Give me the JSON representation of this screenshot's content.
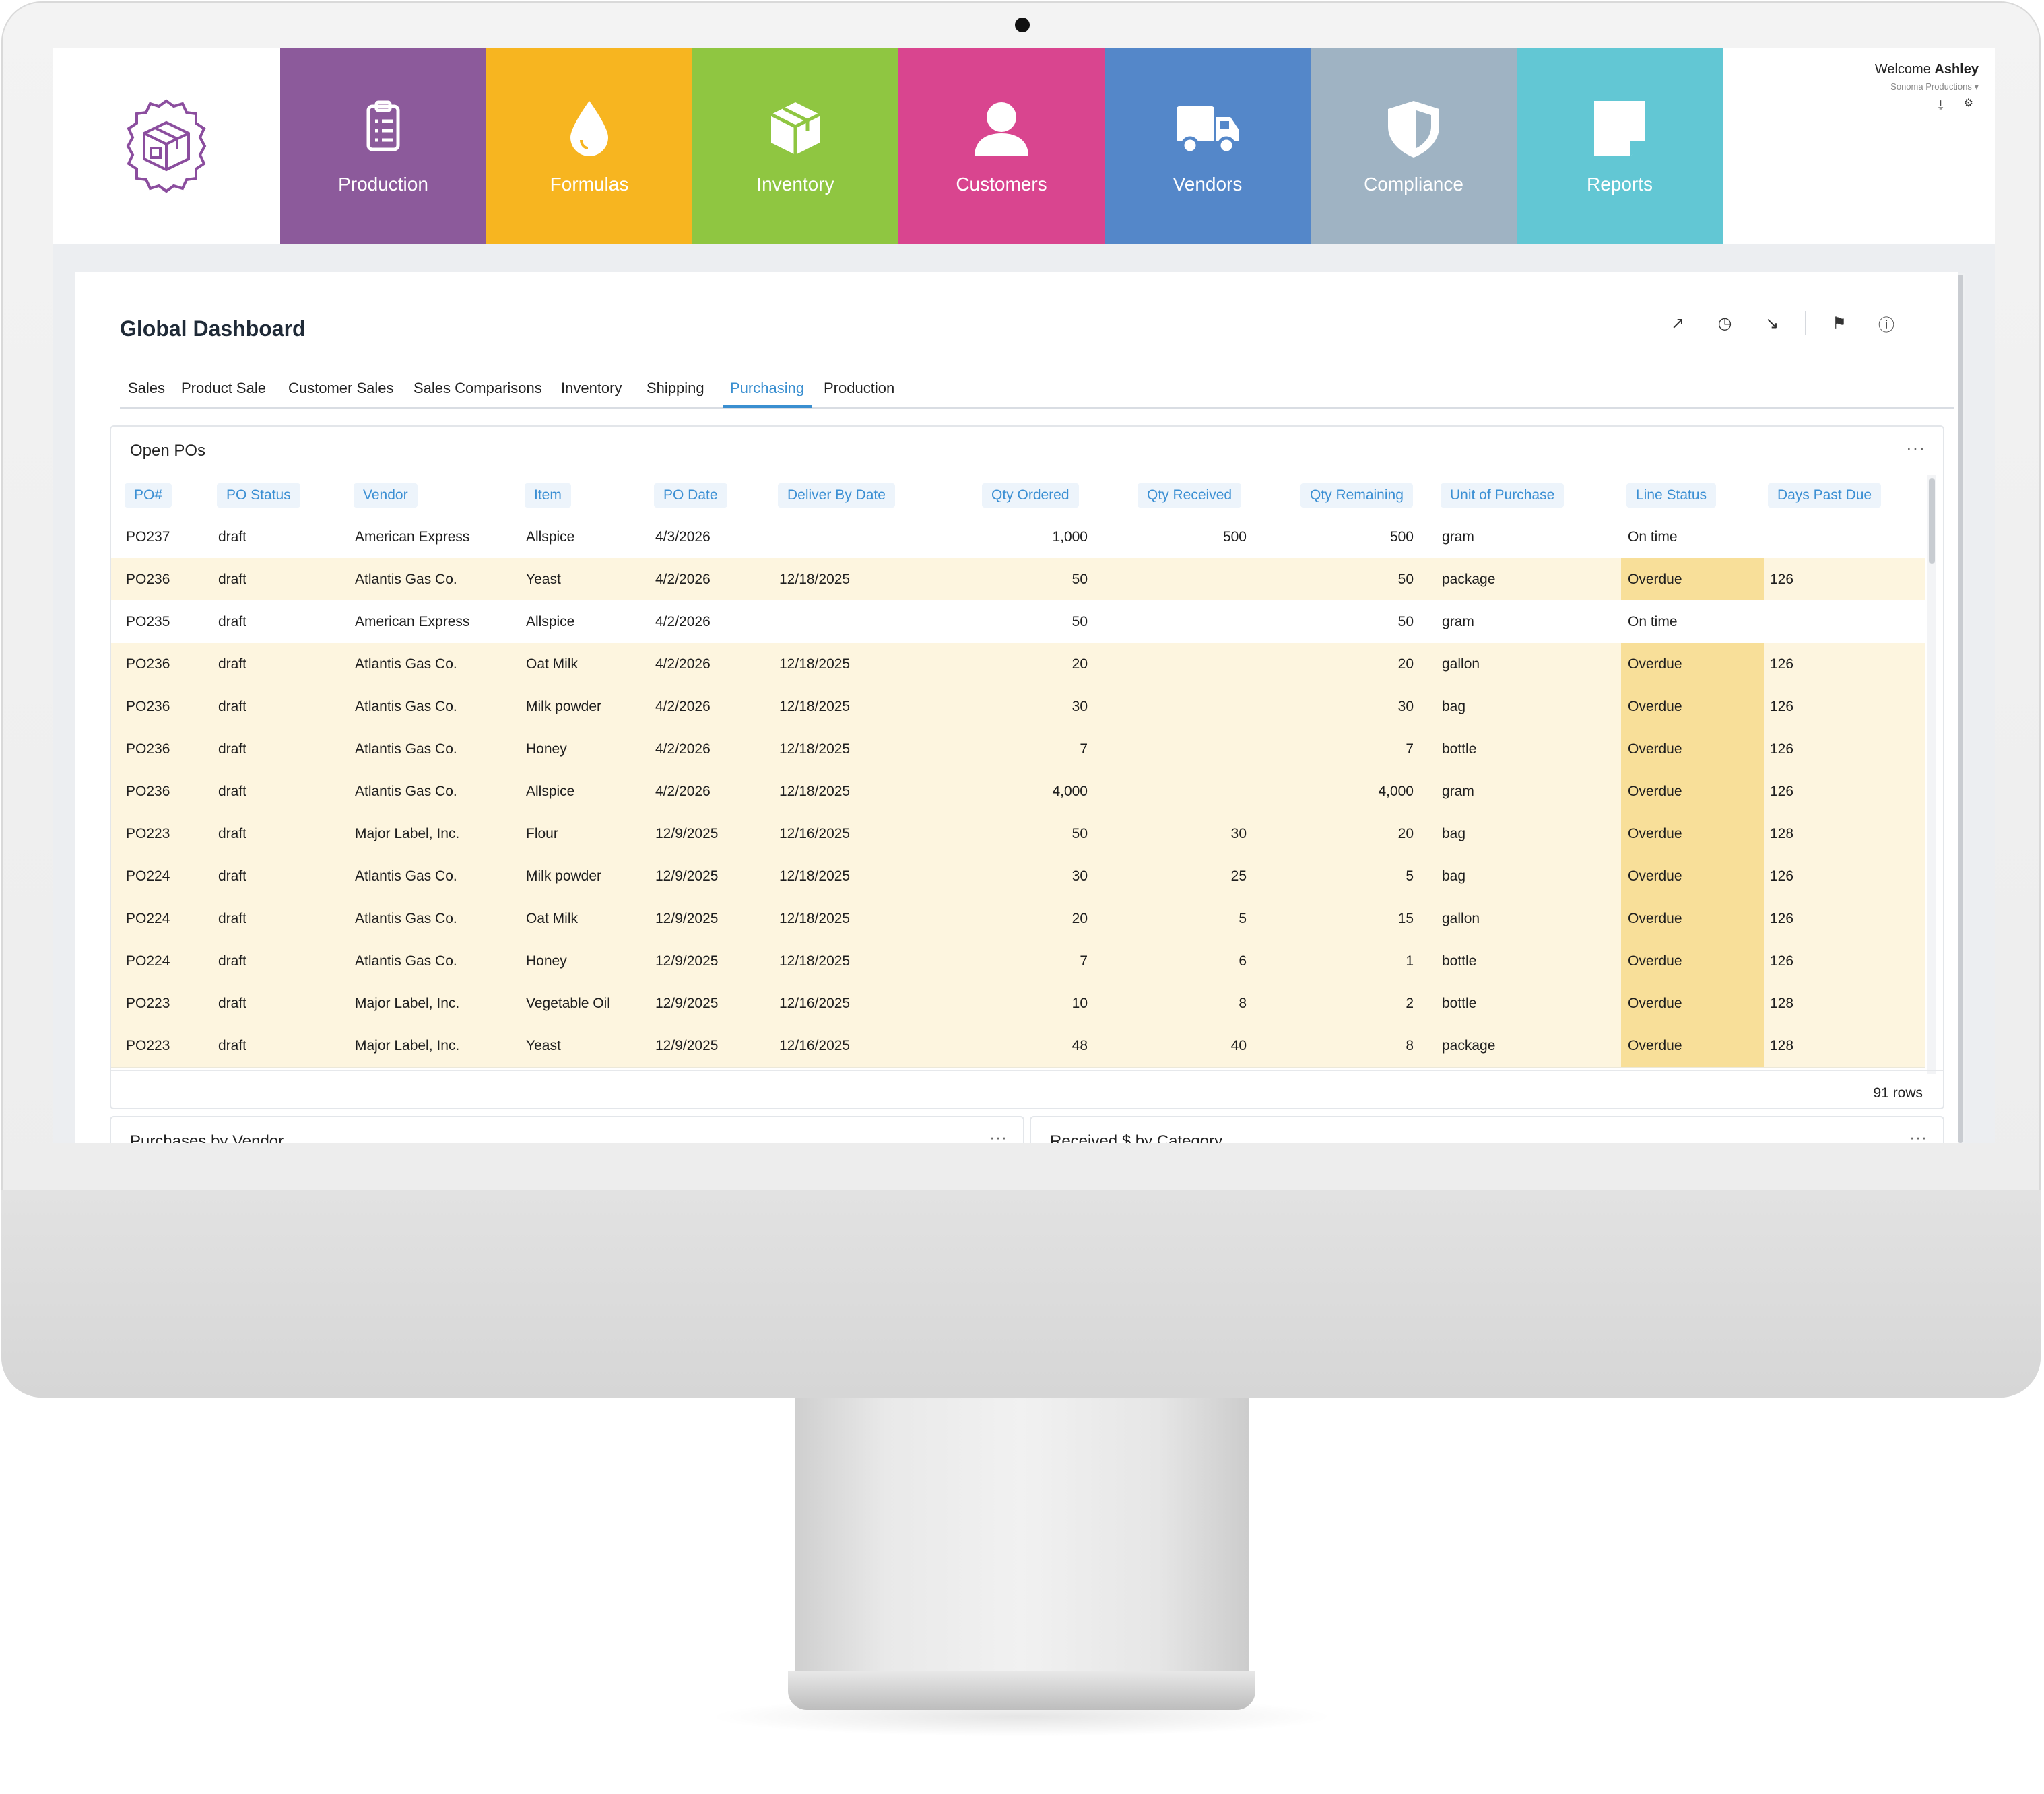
{
  "brand": {
    "logo_icon": "box-badge-icon",
    "logo_color": "#8b4d9e"
  },
  "modules": [
    {
      "label": "Production",
      "icon": "clipboard-icon",
      "color": "#8c5a9b"
    },
    {
      "label": "Formulas",
      "icon": "drop-icon",
      "color": "#f7b520"
    },
    {
      "label": "Inventory",
      "icon": "cube-icon",
      "color": "#8fc641"
    },
    {
      "label": "Customers",
      "icon": "person-icon",
      "color": "#d9458f"
    },
    {
      "label": "Vendors",
      "icon": "truck-icon",
      "color": "#5487c9"
    },
    {
      "label": "Compliance",
      "icon": "shield-icon",
      "color": "#9fb3c3"
    },
    {
      "label": "Reports",
      "icon": "note-icon",
      "color": "#62c7d4"
    }
  ],
  "user": {
    "welcome_prefix": "Welcome",
    "name": "Ashley",
    "org": "Sonoma Productions ▾"
  },
  "dashboard": {
    "title": "Global Dashboard",
    "tabs": [
      "Sales",
      "Product Sale",
      "Customer Sales",
      "Sales Comparisons",
      "Inventory",
      "Shipping",
      "Purchasing",
      "Production"
    ],
    "active_tab": "Purchasing",
    "accent_color": "#3a8fd0"
  },
  "open_pos": {
    "title": "Open POs",
    "menu": "···",
    "columns": [
      "PO#",
      "PO Status",
      "Vendor",
      "Item",
      "PO Date",
      "Deliver By Date",
      "Qty Ordered",
      "Qty Received",
      "Qty Remaining",
      "Unit of Purchase",
      "Line Status",
      "Days Past Due"
    ],
    "rows": [
      [
        "PO237",
        "draft",
        "American Express",
        "Allspice",
        "4/3/2026",
        "",
        "1,000",
        "500",
        "500",
        "gram",
        "On time",
        ""
      ],
      [
        "PO236",
        "draft",
        "Atlantis Gas Co.",
        "Yeast",
        "4/2/2026",
        "12/18/2025",
        "50",
        "",
        "50",
        "package",
        "Overdue",
        "126"
      ],
      [
        "PO235",
        "draft",
        "American Express",
        "Allspice",
        "4/2/2026",
        "",
        "50",
        "",
        "50",
        "gram",
        "On time",
        ""
      ],
      [
        "PO236",
        "draft",
        "Atlantis Gas Co.",
        "Oat Milk",
        "4/2/2026",
        "12/18/2025",
        "20",
        "",
        "20",
        "gallon",
        "Overdue",
        "126"
      ],
      [
        "PO236",
        "draft",
        "Atlantis Gas Co.",
        "Milk powder",
        "4/2/2026",
        "12/18/2025",
        "30",
        "",
        "30",
        "bag",
        "Overdue",
        "126"
      ],
      [
        "PO236",
        "draft",
        "Atlantis Gas Co.",
        "Honey",
        "4/2/2026",
        "12/18/2025",
        "7",
        "",
        "7",
        "bottle",
        "Overdue",
        "126"
      ],
      [
        "PO236",
        "draft",
        "Atlantis Gas Co.",
        "Allspice",
        "4/2/2026",
        "12/18/2025",
        "4,000",
        "",
        "4,000",
        "gram",
        "Overdue",
        "126"
      ],
      [
        "PO223",
        "draft",
        "Major Label, Inc.",
        "Flour",
        "12/9/2025",
        "12/16/2025",
        "50",
        "30",
        "20",
        "bag",
        "Overdue",
        "128"
      ],
      [
        "PO224",
        "draft",
        "Atlantis Gas Co.",
        "Milk powder",
        "12/9/2025",
        "12/18/2025",
        "30",
        "25",
        "5",
        "bag",
        "Overdue",
        "126"
      ],
      [
        "PO224",
        "draft",
        "Atlantis Gas Co.",
        "Oat Milk",
        "12/9/2025",
        "12/18/2025",
        "20",
        "5",
        "15",
        "gallon",
        "Overdue",
        "126"
      ],
      [
        "PO224",
        "draft",
        "Atlantis Gas Co.",
        "Honey",
        "12/9/2025",
        "12/18/2025",
        "7",
        "6",
        "1",
        "bottle",
        "Overdue",
        "126"
      ],
      [
        "PO223",
        "draft",
        "Major Label, Inc.",
        "Vegetable Oil",
        "12/9/2025",
        "12/16/2025",
        "10",
        "8",
        "2",
        "bottle",
        "Overdue",
        "128"
      ],
      [
        "PO223",
        "draft",
        "Major Label, Inc.",
        "Yeast",
        "12/9/2025",
        "12/16/2025",
        "48",
        "40",
        "8",
        "package",
        "Overdue",
        "128"
      ]
    ],
    "row_count": "91 rows",
    "overdue_highlight": "#f8df99",
    "row_highlight": "#fdf5df"
  },
  "bottom_cards": [
    {
      "title": "Purchases by Vendor",
      "menu": "···"
    },
    {
      "title": "Received $ by Category",
      "menu": "···"
    }
  ]
}
